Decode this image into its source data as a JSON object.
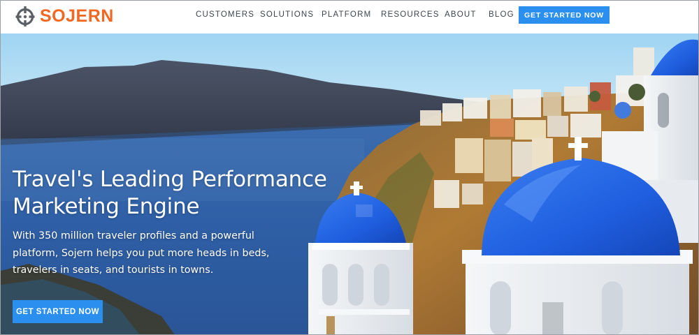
{
  "header": {
    "logo_text": "SOJERN",
    "brand_color": "#f26722",
    "nav": [
      {
        "label": "CUSTOMERS"
      },
      {
        "label": "SOLUTIONS"
      },
      {
        "label": "PLATFORM"
      },
      {
        "label": "RESOURCES"
      },
      {
        "label": "ABOUT"
      },
      {
        "label": "BLOG"
      }
    ],
    "cta_label": "GET STARTED NOW",
    "cta_color": "#2b8ff0"
  },
  "hero": {
    "title_lines": [
      "Travel's Leading Performance",
      "Marketing Engine"
    ],
    "subtitle_lines": [
      "With 350 million traveler profiles and a powerful",
      "platform, Sojern helps you put more heads in beds,",
      "travelers in seats, and tourists in towns."
    ],
    "cta_label": "GET STARTED NOW",
    "background_image": "santorini-coast-photo"
  }
}
